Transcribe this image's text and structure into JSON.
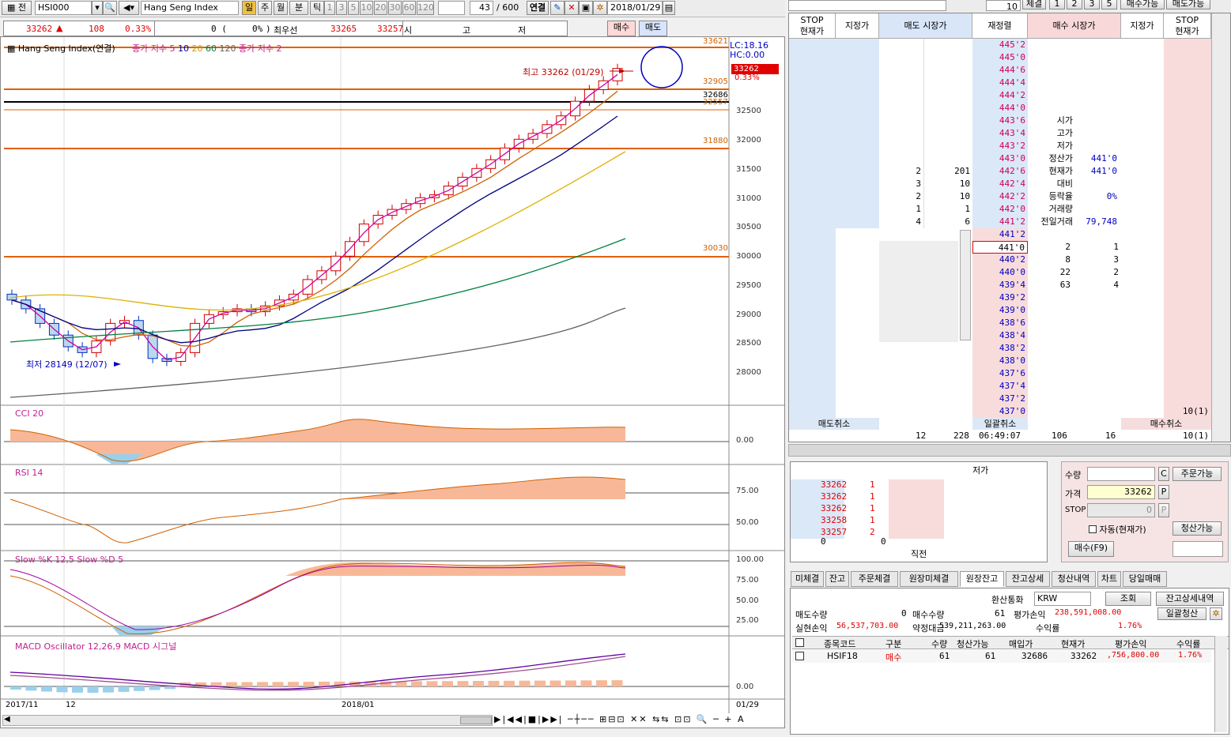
{
  "toolbar": {
    "code": "HSI000",
    "name": "Hang Seng Index",
    "periods": [
      "일",
      "주",
      "월",
      "분",
      "틱"
    ],
    "minute_steps": [
      "1",
      "3",
      "5",
      "10",
      "20",
      "30",
      "60",
      "120"
    ],
    "count": "43",
    "count_max": "/ 600",
    "link_label": "연결",
    "date": "2018/01/29"
  },
  "quote": {
    "price": "33262",
    "change": "108",
    "rate": "0.33%",
    "zero": "0 (",
    "zero_pct": "0%",
    "best_label": "최우선",
    "best_ask": "33265",
    "best_bid": "33257",
    "o_label": "시",
    "h_label": "고",
    "l_label": "저",
    "buy_btn": "매수",
    "sell_btn": "매도"
  },
  "chart": {
    "title": "Hang Seng Index(연결)",
    "ma_legend": "종가 지수 5",
    "ma_periods": [
      "10",
      "20",
      "60",
      "120"
    ],
    "ma_legend2": "종가 지수 2",
    "lc": "LC:18.16",
    "hc": "HC:0.00",
    "hi_note": "최고 33262 (01/29)",
    "lo_note": "최저 28149 (12/07)",
    "last_price": "33262",
    "last_pct": "0.33%",
    "hline_labels": [
      "33621",
      "32905",
      "32686",
      "32557",
      "31880",
      "30030"
    ],
    "y_ticks": [
      "32500",
      "32000",
      "31500",
      "31000",
      "30500",
      "30000",
      "29500",
      "29000",
      "28500",
      "28000"
    ],
    "x_ticks": [
      "2017/11",
      "12",
      "2018/01",
      "01/29"
    ],
    "cci_title": "CCI 20",
    "cci_ticks": [
      "0.00"
    ],
    "rsi_title": "RSI 14",
    "rsi_ticks": [
      "75.00",
      "50.00"
    ],
    "stoch_title": "Slow %K 12,5   Slow %D 5",
    "stoch_ticks": [
      "100.00",
      "75.00",
      "50.00",
      "25.00"
    ],
    "macd_title": "MACD Oscillator 12,26,9  MACD   시그널",
    "macd_ticks": [
      "0.00"
    ]
  },
  "orderbook": {
    "top": {
      "qty": "10",
      "label": "체결"
    },
    "top_btns": [
      "1",
      "2",
      "3",
      "5"
    ],
    "top_avail": [
      "매수가능",
      "매도가능"
    ],
    "headers": {
      "stop_left": "STOP",
      "cur_left": "현재가",
      "limit_left": "지정가",
      "sell_mkt": "매도 시장가",
      "price": "재정렬",
      "buy_mkt": "매수 시장가",
      "limit_right": "지정가",
      "stop_right": "STOP",
      "cur_right": "현재가"
    },
    "upper": [
      {
        "p": "445'2"
      },
      {
        "p": "445'0"
      },
      {
        "p": "444'6"
      },
      {
        "p": "444'4"
      },
      {
        "p": "444'2"
      },
      {
        "p": "444'0"
      },
      {
        "p": "443'6",
        "k": "시가"
      },
      {
        "p": "443'4",
        "k": "고가"
      },
      {
        "p": "443'2",
        "k": "저가"
      },
      {
        "p": "443'0",
        "k": "정산가",
        "v": "441'0"
      },
      {
        "p": "442'6",
        "c": "2",
        "q": "201",
        "k": "현재가",
        "v": "441'0"
      },
      {
        "p": "442'4",
        "c": "3",
        "q": "10",
        "k": "대비"
      },
      {
        "p": "442'2",
        "c": "2",
        "q": "10",
        "k": "등락율",
        "v": "0%"
      },
      {
        "p": "442'0",
        "c": "1",
        "q": "1",
        "k": "거래량"
      },
      {
        "p": "441'2",
        "c": "4",
        "q": "6",
        "k": "전일거래",
        "v": "79,748"
      }
    ],
    "lower": [
      {
        "p": "441'2"
      },
      {
        "p": "441'0",
        "q": "2",
        "c": "1"
      },
      {
        "p": "440'2",
        "q": "8",
        "c": "3"
      },
      {
        "p": "440'0",
        "q": "22",
        "c": "2"
      },
      {
        "p": "439'4",
        "q": "63",
        "c": "4"
      },
      {
        "p": "439'2"
      },
      {
        "p": "439'0"
      },
      {
        "p": "438'6"
      },
      {
        "p": "438'4"
      },
      {
        "p": "438'2"
      },
      {
        "p": "438'0"
      },
      {
        "p": "437'6"
      },
      {
        "p": "437'4"
      },
      {
        "p": "437'2"
      },
      {
        "p": "437'0",
        "r": "10(1)"
      }
    ],
    "cancel_sell": "매도취소",
    "cancel_all": "일괄취소",
    "cancel_buy": "매수취소",
    "footer": {
      "c1": "12",
      "c2": "228",
      "time": "06:49:07",
      "c3": "106",
      "c4": "16",
      "c5": "10(1)"
    }
  },
  "ticks": {
    "header_label": "저가",
    "rows": [
      {
        "p": "33262",
        "q": "1"
      },
      {
        "p": "33262",
        "q": "1"
      },
      {
        "p": "33262",
        "q": "1"
      },
      {
        "p": "33258",
        "q": "1"
      },
      {
        "p": "33257",
        "q": "2"
      }
    ],
    "zero_a": "0",
    "zero_b": "0",
    "prev_label": "직전"
  },
  "order": {
    "qty_label": "수량",
    "c_btn": "C",
    "avail_btn": "주문가능",
    "price_label": "가격",
    "price_value": "33262",
    "p_btn": "P",
    "stop_label": "STOP",
    "stop_value": "0",
    "auto_label": "자동(현재가)",
    "liq_btn": "청산가능",
    "buy_btn": "매수(F9)"
  },
  "tabs": [
    "미체결",
    "잔고",
    "주문체결",
    "원장미체결",
    "원장잔고",
    "잔고상세",
    "청산내역",
    "차트",
    "당일매매"
  ],
  "active_tab": "원장잔고",
  "balance": {
    "currency_label": "환산통화",
    "currency": "KRW",
    "query_btn": "조회",
    "detail_btn": "잔고상세내역",
    "sell_qty_label": "매도수량",
    "sell_qty": "0",
    "buy_qty_label": "매수수량",
    "buy_qty": "61",
    "eval_label": "평가손익",
    "eval": "238,591,008.00",
    "liq_all": "일괄청산",
    "realized_label": "실현손익",
    "realized": "56,537,703.00",
    "contract_label": "약정대금",
    "contract": "539,211,263.00",
    "ret_label": "수익률",
    "ret": "1.76%",
    "cols": [
      "종목코드",
      "구분",
      "수량",
      "청산가능",
      "매입가",
      "현재가",
      "평가손익",
      "수익률"
    ],
    "rows": [
      {
        "code": "HSIF18",
        "side": "매수",
        "qty": "61",
        "liq": "61",
        "buy": "32686",
        "cur": "33262",
        "pnl": ",756,800.00",
        "ret": "1.76%"
      }
    ]
  }
}
